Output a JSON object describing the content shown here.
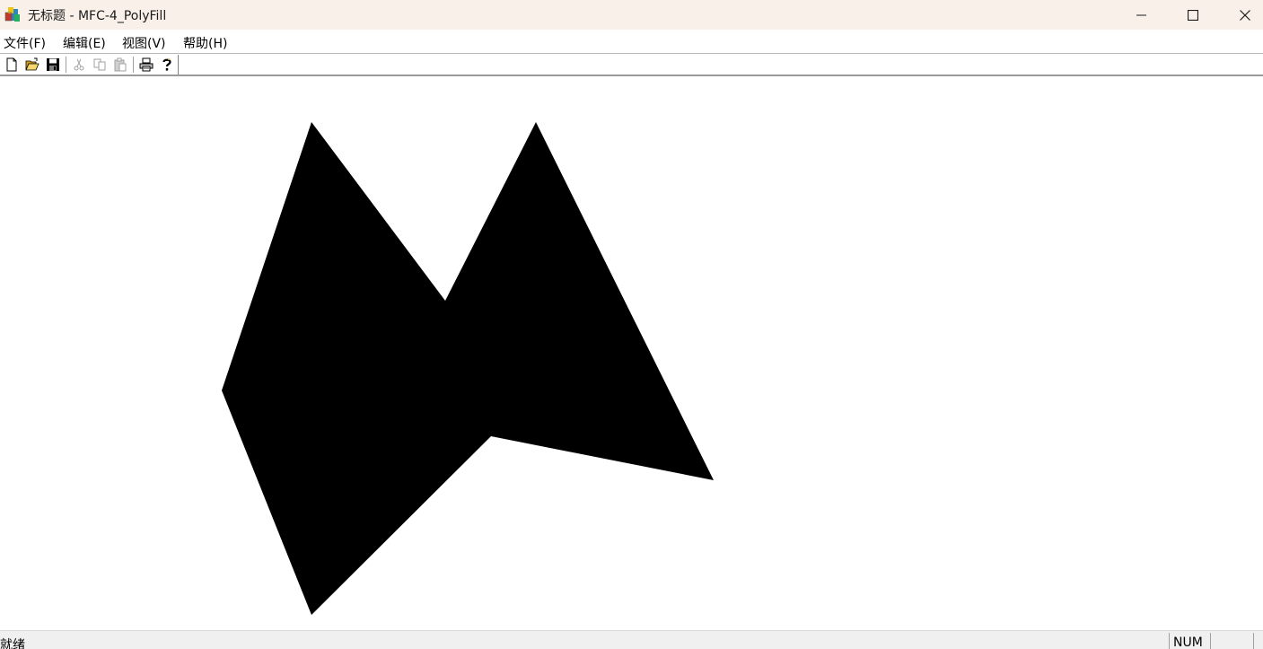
{
  "window": {
    "title": "无标题 - MFC-4_PolyFill"
  },
  "menubar": {
    "items": [
      {
        "label": "文件(F)"
      },
      {
        "label": "编辑(E)"
      },
      {
        "label": "视图(V)"
      },
      {
        "label": "帮助(H)"
      }
    ]
  },
  "toolbar": {
    "buttons": [
      {
        "icon": "new-document-icon",
        "enabled": true
      },
      {
        "icon": "open-folder-icon",
        "enabled": true
      },
      {
        "icon": "save-disk-icon",
        "enabled": true
      },
      {
        "icon": "cut-scissors-icon",
        "enabled": false
      },
      {
        "icon": "copy-icon",
        "enabled": false
      },
      {
        "icon": "paste-icon",
        "enabled": false
      },
      {
        "icon": "print-icon",
        "enabled": true
      },
      {
        "icon": "help-question-icon",
        "enabled": true
      }
    ]
  },
  "canvas": {
    "fill_color": "#000000",
    "background": "#ffffff"
  },
  "statusbar": {
    "text": "就绪",
    "num_indicator": "NUM"
  }
}
